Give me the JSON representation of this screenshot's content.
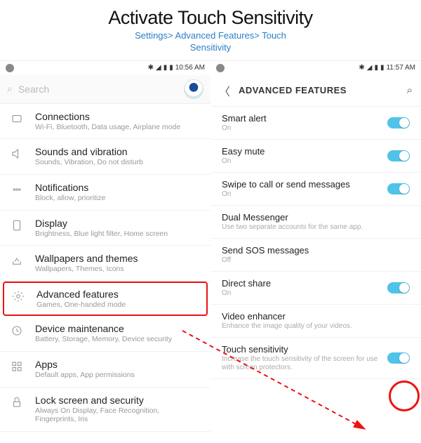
{
  "header": {
    "title": "Activate Touch Sensitivity",
    "breadcrumb_line1": "Settings> Advanced Features> Touch",
    "breadcrumb_line2": "Sensitivity"
  },
  "left_screen": {
    "status": {
      "time": "10:56 AM"
    },
    "search_placeholder": "Search",
    "items": [
      {
        "name": "Connections",
        "sub": "Wi-Fi, Bluetooth, Data usage, Airplane mode",
        "icon": "connections-icon"
      },
      {
        "name": "Sounds and vibration",
        "sub": "Sounds, Vibration, Do not disturb",
        "icon": "sound-icon"
      },
      {
        "name": "Notifications",
        "sub": "Block, allow, prioritize",
        "icon": "notifications-icon"
      },
      {
        "name": "Display",
        "sub": "Brightness, Blue light filter, Home screen",
        "icon": "display-icon"
      },
      {
        "name": "Wallpapers and themes",
        "sub": "Wallpapers, Themes, Icons",
        "icon": "wallpaper-icon"
      },
      {
        "name": "Advanced features",
        "sub": "Games, One-handed mode",
        "icon": "advanced-icon"
      },
      {
        "name": "Device maintenance",
        "sub": "Battery, Storage, Memory, Device security",
        "icon": "maintenance-icon"
      },
      {
        "name": "Apps",
        "sub": "Default apps, App permissions",
        "icon": "apps-icon"
      },
      {
        "name": "Lock screen and security",
        "sub": "Always On Display, Face Recognition, Fingerprints, Iris",
        "icon": "lock-icon"
      }
    ]
  },
  "right_screen": {
    "status": {
      "time": "11:57 AM"
    },
    "header_title": "ADVANCED FEATURES",
    "items": [
      {
        "name": "Smart alert",
        "sub": "On",
        "toggle": true
      },
      {
        "name": "Easy mute",
        "sub": "On",
        "toggle": true
      },
      {
        "name": "Swipe to call or send messages",
        "sub": "On",
        "toggle": true
      },
      {
        "name": "Dual Messenger",
        "sub": "Use two separate accounts for the same app.",
        "toggle": false
      },
      {
        "name": "Send SOS messages",
        "sub": "Off",
        "toggle": false
      },
      {
        "name": "Direct share",
        "sub": "On",
        "toggle": true
      },
      {
        "name": "Video enhancer",
        "sub": "Enhance the image quality of your videos.",
        "toggle": false
      },
      {
        "name": "Touch sensitivity",
        "sub": "Increase the touch sensitivity of the screen for use with screen protectors.",
        "toggle": true
      }
    ]
  }
}
